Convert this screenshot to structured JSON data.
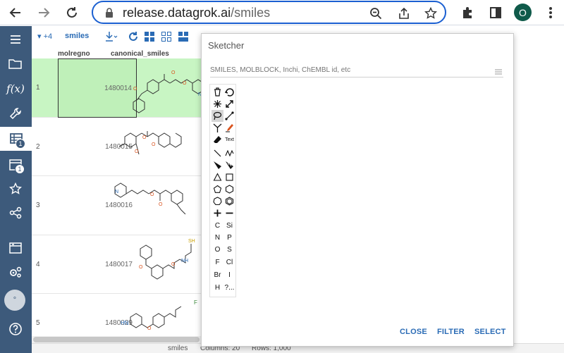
{
  "browser": {
    "url_host": "release.datagrok.ai",
    "url_path": "/smiles",
    "profile_initial": "O"
  },
  "sidebar": {
    "items": [
      {
        "icon": "menu-icon"
      },
      {
        "icon": "folder-icon"
      },
      {
        "icon": "function-icon"
      },
      {
        "icon": "wrench-icon"
      },
      {
        "icon": "table-icon",
        "badge": "1",
        "active": true
      },
      {
        "icon": "window-icon",
        "badge": "1"
      },
      {
        "icon": "star-icon"
      },
      {
        "icon": "share-icon"
      },
      {
        "icon": "dashboard-icon"
      },
      {
        "icon": "settings-icon"
      },
      {
        "icon": "dot-icon",
        "label": "°"
      },
      {
        "icon": "help-icon"
      }
    ]
  },
  "toolbar": {
    "plus_count": "+4",
    "table_name": "smiles"
  },
  "grid": {
    "columns": [
      "molregno",
      "canonical_smiles"
    ],
    "rows": [
      {
        "num": "1",
        "molregno": "1480014"
      },
      {
        "num": "2",
        "molregno": "1480015"
      },
      {
        "num": "3",
        "molregno": "1480016"
      },
      {
        "num": "4",
        "molregno": "1480017"
      },
      {
        "num": "5",
        "molregno": "1480029"
      }
    ]
  },
  "status": {
    "table": "smiles",
    "columns": "Columns: 20",
    "rows": "Rows: 1,000"
  },
  "sketcher": {
    "title": "Sketcher",
    "placeholder": "SMILES, MOLBLOCK, Inchi, ChEMBL id, etc",
    "text_tool": "Text",
    "atoms": [
      [
        "C",
        "Si"
      ],
      [
        "N",
        "P"
      ],
      [
        "O",
        "S"
      ],
      [
        "F",
        "Cl"
      ],
      [
        "Br",
        "I"
      ],
      [
        "H",
        "?..."
      ]
    ],
    "buttons": {
      "close": "CLOSE",
      "filter": "FILTER",
      "select": "SELECT"
    }
  },
  "colors": {
    "sidebar": "#3d5a7b",
    "accent": "#2a6bb5",
    "selected_row": "#c8f5c3",
    "url_border": "#1a5fd1"
  }
}
